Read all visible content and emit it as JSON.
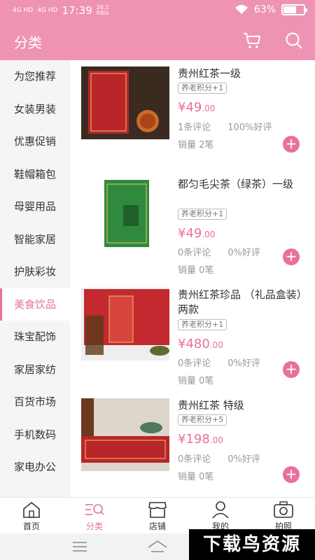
{
  "status": {
    "signal1": "4G HD",
    "signal2": "4G HD",
    "time": "17:39",
    "speed_value": "26.1",
    "speed_unit": "KB/s",
    "battery": "63%",
    "battery_level": 0.63
  },
  "header": {
    "title": "分类"
  },
  "sidebar": {
    "items": [
      {
        "label": "为您推荐"
      },
      {
        "label": "女装男装"
      },
      {
        "label": "优惠促销"
      },
      {
        "label": "鞋帽箱包"
      },
      {
        "label": "母婴用品"
      },
      {
        "label": "智能家居"
      },
      {
        "label": "护肤彩妆"
      },
      {
        "label": "美食饮品"
      },
      {
        "label": "珠宝配饰"
      },
      {
        "label": "家居家纺"
      },
      {
        "label": "百货市场"
      },
      {
        "label": "手机数码"
      },
      {
        "label": "家电办公"
      }
    ],
    "active_index": 7
  },
  "products": [
    {
      "name": "贵州红茶一级",
      "badge": "养老积分+1",
      "price_int": "¥49",
      "price_dec": ".00",
      "reviews": "1条评论",
      "rating": "100%好评",
      "sales": "销量 2笔",
      "image_label": "贵州红茶"
    },
    {
      "name": "都匀毛尖茶（绿茶）一级",
      "badge": "养老积分+1",
      "price_int": "¥49",
      "price_dec": ".00",
      "reviews": "0条评论",
      "rating": "0%好评",
      "sales": "销量 0笔",
      "image_label": "都匀毛尖"
    },
    {
      "name": "贵州红茶珍品 （礼品盒装）两款",
      "badge": "养老积分+1",
      "price_int": "¥480",
      "price_dec": ".00",
      "reviews": "0条评论",
      "rating": "0%好评",
      "sales": "销量 0笔",
      "image_label": "贵州红茶"
    },
    {
      "name": "贵州红茶 特级",
      "badge": "养老积分+5",
      "price_int": "¥198",
      "price_dec": ".00",
      "reviews": "0条评论",
      "rating": "0%好评",
      "sales": "销量 0笔",
      "image_label": "都匀红茶"
    }
  ],
  "nav": {
    "items": [
      {
        "label": "首页",
        "icon": "home-icon"
      },
      {
        "label": "分类",
        "icon": "category-search-icon"
      },
      {
        "label": "店铺",
        "icon": "store-icon"
      },
      {
        "label": "我的",
        "icon": "user-icon"
      },
      {
        "label": "拍照",
        "icon": "camera-icon"
      }
    ],
    "active_index": 1
  },
  "watermark": "下载鸟资源",
  "colors": {
    "brand": "#ee93b4",
    "accent": "#e8709e"
  }
}
